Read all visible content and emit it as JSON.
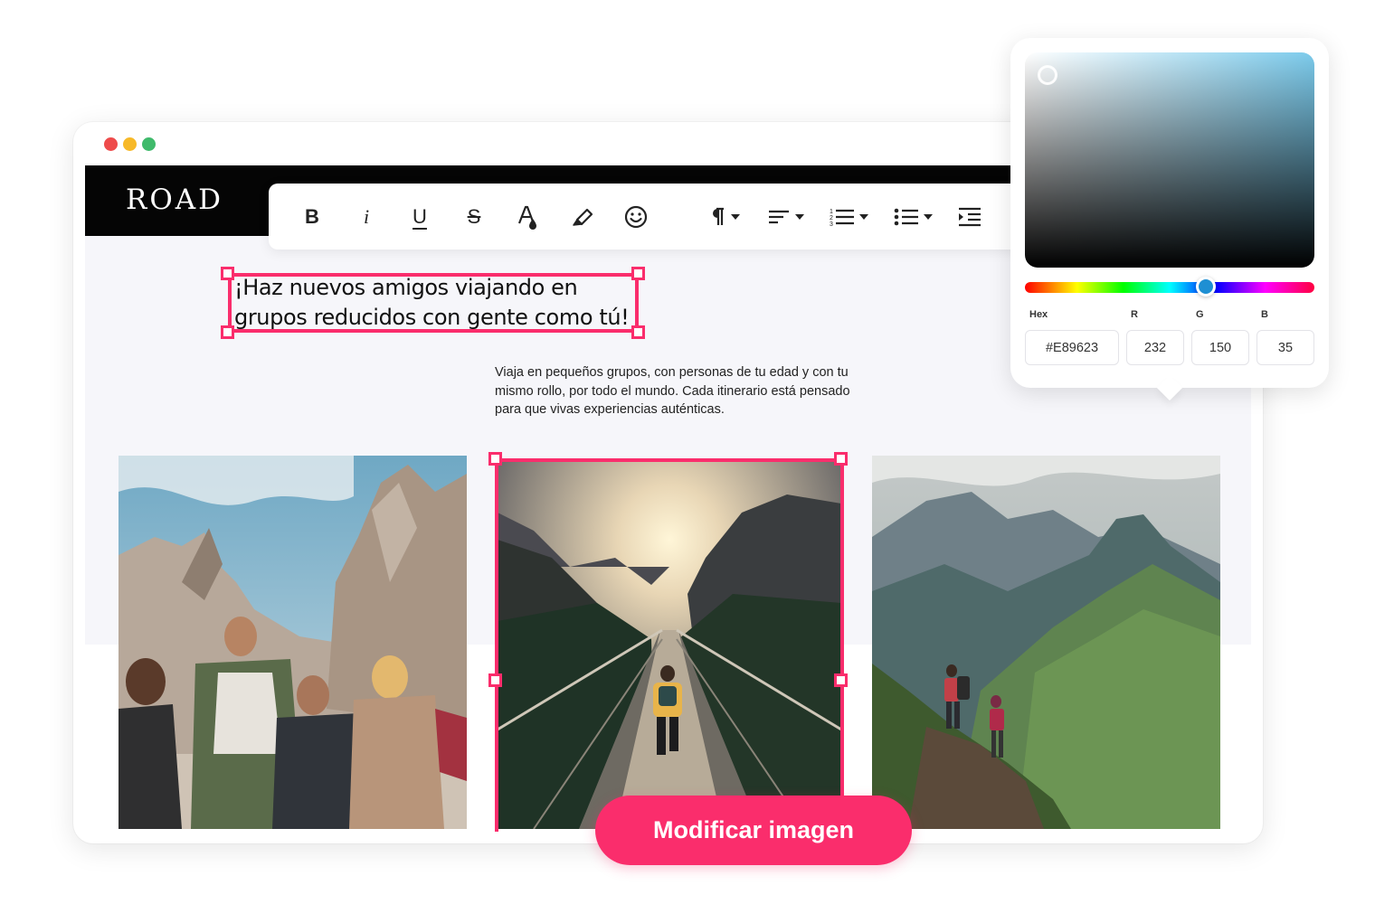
{
  "site": {
    "logo": "ROAD"
  },
  "toolbar": {
    "bold": "B",
    "italic": "i",
    "underline": "U",
    "strike": "S"
  },
  "content": {
    "headline": "¡Haz nuevos amigos viajando en grupos reducidos con gente como tú!",
    "body": "Viaja en pequeños grupos, con personas de tu edad y con tu mismo rollo, por todo el mundo. Cada itinerario está pensado para que vivas experiencias auténticas."
  },
  "cta": {
    "label": "Modificar imagen"
  },
  "color_picker": {
    "hex_label": "Hex",
    "r_label": "R",
    "g_label": "G",
    "b_label": "B",
    "hex": "#E89623",
    "r": "232",
    "g": "150",
    "b": "35"
  },
  "colors": {
    "accent": "#fa2d6c",
    "navbar": "#050505",
    "page_bg": "#f6f6fa"
  }
}
